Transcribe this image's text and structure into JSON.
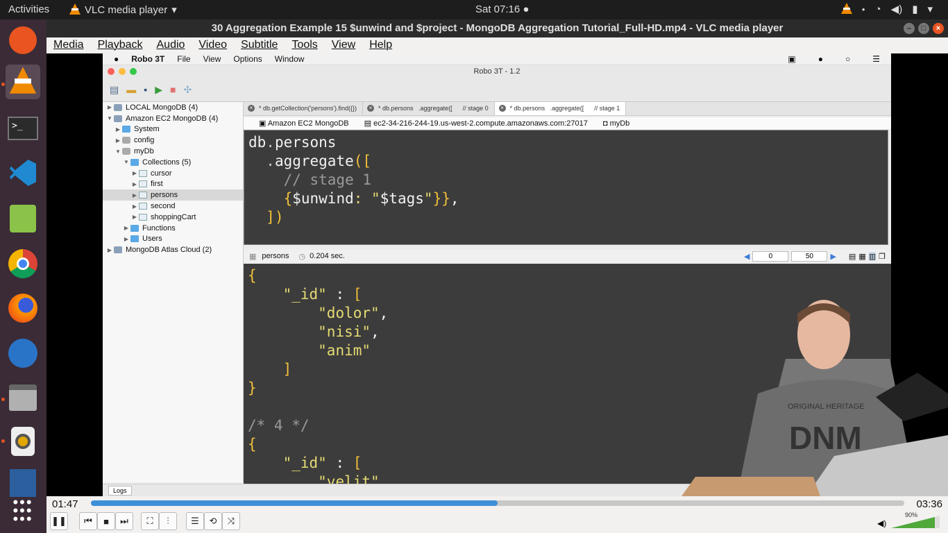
{
  "topbar": {
    "activities": "Activities",
    "app": "VLC media player",
    "clock": "Sat 07:16"
  },
  "vlc": {
    "title": "30 Aggregation Example 15 $unwind and $project - MongoDB Aggregation Tutorial_Full-HD.mp4 - VLC media player",
    "menu": [
      "Media",
      "Playback",
      "Audio",
      "Video",
      "Subtitle",
      "Tools",
      "View",
      "Help"
    ],
    "time_elapsed": "01:47",
    "time_total": "03:36",
    "progress": 0.5,
    "volume": "90%"
  },
  "mac_menu": {
    "app": "Robo 3T",
    "items": [
      "File",
      "View",
      "Options",
      "Window"
    ]
  },
  "robo": {
    "title": "Robo 3T - 1.2",
    "tree": [
      {
        "label": "LOCAL MongoDB (4)",
        "depth": 0,
        "arrow": "▶",
        "icon": "db"
      },
      {
        "label": "Amazon EC2 MongoDB (4)",
        "depth": 0,
        "arrow": "▼",
        "icon": "db"
      },
      {
        "label": "System",
        "depth": 1,
        "arrow": "▶",
        "icon": "folder"
      },
      {
        "label": "config",
        "depth": 1,
        "arrow": "▶",
        "icon": "cyl"
      },
      {
        "label": "myDb",
        "depth": 1,
        "arrow": "▼",
        "icon": "cyl"
      },
      {
        "label": "Collections (5)",
        "depth": 2,
        "arrow": "▼",
        "icon": "folder"
      },
      {
        "label": "cursor",
        "depth": 3,
        "arrow": "▶",
        "icon": "tbl"
      },
      {
        "label": "first",
        "depth": 3,
        "arrow": "▶",
        "icon": "tbl"
      },
      {
        "label": "persons",
        "depth": 3,
        "arrow": "▶",
        "icon": "tbl",
        "selected": true
      },
      {
        "label": "second",
        "depth": 3,
        "arrow": "▶",
        "icon": "tbl"
      },
      {
        "label": "shoppingCart",
        "depth": 3,
        "arrow": "▶",
        "icon": "tbl"
      },
      {
        "label": "Functions",
        "depth": 2,
        "arrow": "▶",
        "icon": "folder"
      },
      {
        "label": "Users",
        "depth": 2,
        "arrow": "▶",
        "icon": "folder"
      },
      {
        "label": "MongoDB Atlas Cloud (2)",
        "depth": 0,
        "arrow": "▶",
        "icon": "db"
      }
    ],
    "tabs": [
      {
        "label": "* db.getCollection('persons').find({})"
      },
      {
        "label": "* db.persons   .aggregate([      // stage 0"
      },
      {
        "label": "* db.persons   .aggregate([      // stage 1",
        "active": true
      }
    ],
    "connection": {
      "server": "Amazon EC2 MongoDB",
      "host": "ec2-34-216-244-19.us-west-2.compute.amazonaws.com:27017",
      "db": "myDb"
    },
    "result": {
      "collection": "persons",
      "time": "0.204 sec.",
      "page_from": "0",
      "page_size": "50"
    },
    "logs": "Logs"
  }
}
